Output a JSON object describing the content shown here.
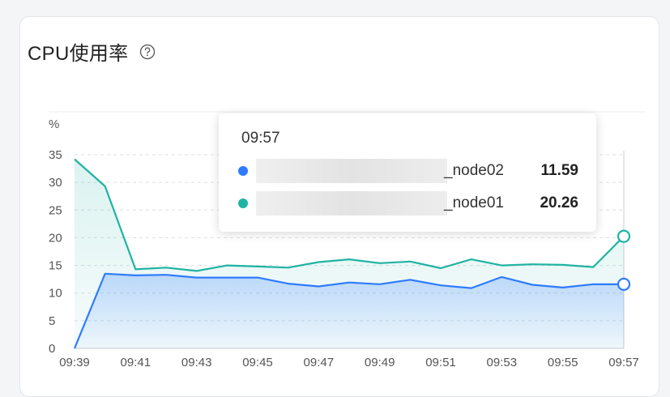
{
  "panel": {
    "title": "CPU使用率",
    "help_icon": "question-circle-icon"
  },
  "colors": {
    "node02": "#2f7bff",
    "node01": "#1fb3a3"
  },
  "tooltip": {
    "time": "09:57",
    "rows": [
      {
        "name": "_node02",
        "value": "11.59"
      },
      {
        "name": "_node01",
        "value": "20.26"
      }
    ]
  },
  "chart_data": {
    "type": "area",
    "unit": "%",
    "x": [
      "09:39",
      "09:40",
      "09:41",
      "09:42",
      "09:43",
      "09:44",
      "09:45",
      "09:46",
      "09:47",
      "09:48",
      "09:49",
      "09:50",
      "09:51",
      "09:52",
      "09:53",
      "09:54",
      "09:55",
      "09:56",
      "09:57"
    ],
    "x_tick_labels": [
      "09:39",
      "09:41",
      "09:43",
      "09:45",
      "09:47",
      "09:49",
      "09:51",
      "09:53",
      "09:55",
      "09:57"
    ],
    "ylim": [
      0,
      35
    ],
    "yticks": [
      0,
      5,
      10,
      15,
      20,
      25,
      30,
      35
    ],
    "grid": "horizontal dashed",
    "series": [
      {
        "name": "_node02",
        "color": "#2f7bff",
        "values": [
          0,
          13.5,
          13.2,
          13.3,
          12.8,
          12.8,
          12.8,
          11.7,
          11.2,
          11.9,
          11.6,
          12.4,
          11.4,
          10.9,
          12.9,
          11.5,
          11.0,
          11.6,
          11.59
        ]
      },
      {
        "name": "_node01",
        "color": "#1fb3a3",
        "values": [
          34.2,
          29.3,
          14.3,
          14.6,
          14.0,
          15.0,
          14.8,
          14.6,
          15.6,
          16.1,
          15.4,
          15.7,
          14.5,
          16.1,
          15.0,
          15.2,
          15.1,
          14.7,
          20.26
        ]
      }
    ]
  }
}
